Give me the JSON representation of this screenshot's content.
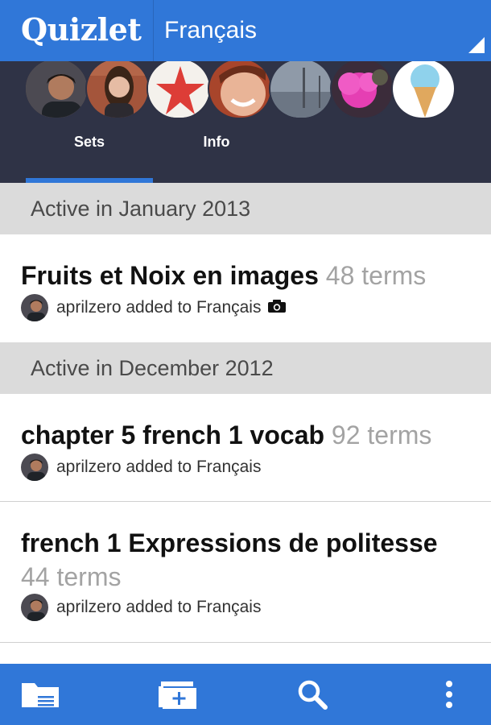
{
  "app": {
    "brand": "Quizlet",
    "group_title": "Français",
    "accent_color": "#3077d8",
    "header_dark_color": "#2f3346"
  },
  "header": {
    "avatars": [
      "person-photo",
      "person-photo",
      "starfish-photo",
      "person-photo",
      "landscape-photo",
      "pink-feather-photo",
      "ice-cream-photo"
    ],
    "tabs": [
      {
        "label": "Sets",
        "active": true
      },
      {
        "label": "Info",
        "active": false
      }
    ]
  },
  "sections": [
    {
      "header": "Active in January 2013",
      "items": [
        {
          "title": "Fruits et Noix en images",
          "terms": "48 terms",
          "meta": "aprilzero added to Français",
          "has_camera_icon": true
        }
      ]
    },
    {
      "header": "Active in December 2012",
      "items": [
        {
          "title": "chapter 5 french 1 vocab",
          "terms": "92 terms",
          "meta": "aprilzero added to Français",
          "has_camera_icon": false
        },
        {
          "title": "french 1 Expressions de politesse",
          "terms": "44 terms",
          "meta": "aprilzero added to Français",
          "has_camera_icon": false
        }
      ]
    }
  ],
  "bottom_bar": {
    "icons": [
      "folder-icon",
      "add-set-icon",
      "search-icon",
      "overflow-menu-icon"
    ]
  }
}
